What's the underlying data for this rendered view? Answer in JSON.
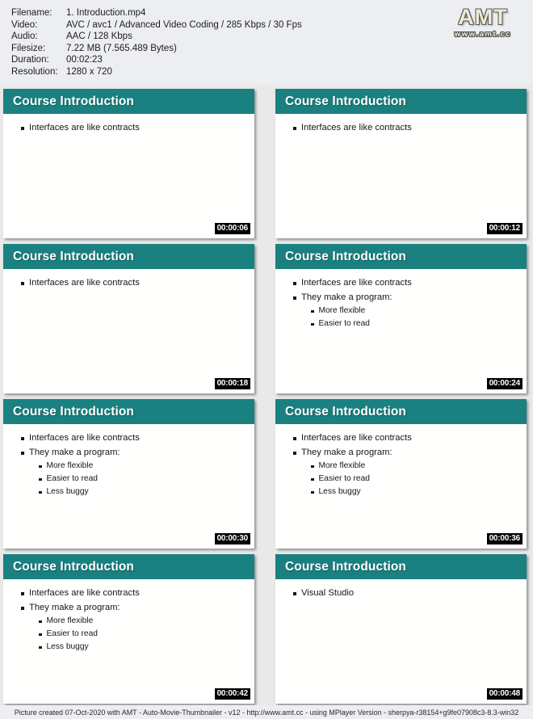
{
  "header": {
    "metadata": [
      {
        "label": "Filename:",
        "value": "1. Introduction.mp4"
      },
      {
        "label": "Video:",
        "value": "AVC / avc1 / Advanced Video Coding / 285 Kbps / 30 Fps"
      },
      {
        "label": "Audio:",
        "value": "AAC / 128 Kbps"
      },
      {
        "label": "Filesize:",
        "value": "7.22 MB (7.565.489 Bytes)"
      },
      {
        "label": "Duration:",
        "value": "00:02:23"
      },
      {
        "label": "Resolution:",
        "value": "1280 x 720"
      }
    ],
    "logo": {
      "name": "AMT",
      "url": "www.amt.cc"
    }
  },
  "colors": {
    "slide_header_teal": "#1a8080",
    "page_background": "#e9e9e9",
    "panel_background": "#eceef2",
    "timestamp_background": "#000000",
    "logo_text": "#eeead8"
  },
  "thumbnails": [
    {
      "title": "Course Introduction",
      "timestamp": "00:00:06",
      "bullets": [
        {
          "level": 1,
          "text": "Interfaces are like contracts"
        }
      ]
    },
    {
      "title": "Course Introduction",
      "timestamp": "00:00:12",
      "bullets": [
        {
          "level": 1,
          "text": "Interfaces are like contracts"
        }
      ]
    },
    {
      "title": "Course Introduction",
      "timestamp": "00:00:18",
      "bullets": [
        {
          "level": 1,
          "text": "Interfaces are like contracts"
        }
      ]
    },
    {
      "title": "Course Introduction",
      "timestamp": "00:00:24",
      "bullets": [
        {
          "level": 1,
          "text": "Interfaces are like contracts"
        },
        {
          "level": 1,
          "text": "They make a program:"
        },
        {
          "level": 2,
          "text": "More flexible"
        },
        {
          "level": 2,
          "text": "Easier to read"
        }
      ]
    },
    {
      "title": "Course Introduction",
      "timestamp": "00:00:30",
      "bullets": [
        {
          "level": 1,
          "text": "Interfaces are like contracts"
        },
        {
          "level": 1,
          "text": "They make a program:"
        },
        {
          "level": 2,
          "text": "More flexible"
        },
        {
          "level": 2,
          "text": "Easier to read"
        },
        {
          "level": 2,
          "text": "Less buggy"
        }
      ]
    },
    {
      "title": "Course Introduction",
      "timestamp": "00:00:36",
      "bullets": [
        {
          "level": 1,
          "text": "Interfaces are like contracts"
        },
        {
          "level": 1,
          "text": "They make a program:"
        },
        {
          "level": 2,
          "text": "More flexible"
        },
        {
          "level": 2,
          "text": "Easier to read"
        },
        {
          "level": 2,
          "text": "Less buggy"
        }
      ]
    },
    {
      "title": "Course Introduction",
      "timestamp": "00:00:42",
      "bullets": [
        {
          "level": 1,
          "text": "Interfaces are like contracts"
        },
        {
          "level": 1,
          "text": "They make a program:"
        },
        {
          "level": 2,
          "text": "More flexible"
        },
        {
          "level": 2,
          "text": "Easier to read"
        },
        {
          "level": 2,
          "text": "Less buggy"
        }
      ]
    },
    {
      "title": "Course Introduction",
      "timestamp": "00:00:48",
      "bullets": [
        {
          "level": 1,
          "text": "Visual Studio"
        }
      ]
    }
  ],
  "footer": {
    "text": "Picture created 07-Oct-2020 with AMT - Auto-Movie-Thumbnailer - v12 - http://www.amt.cc - using MPlayer Version - sherpya-r38154+g9fe07908c3-8.3-win32"
  }
}
